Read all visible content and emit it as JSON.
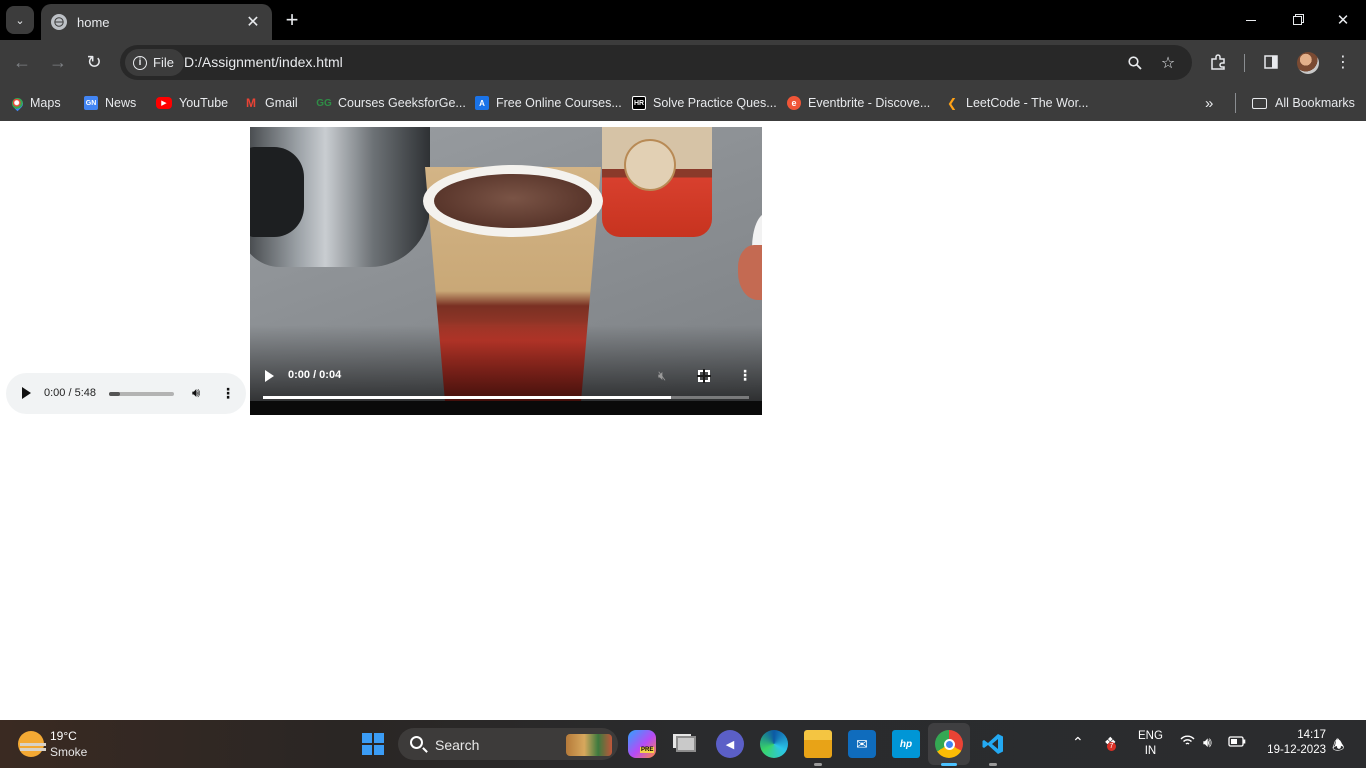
{
  "browser": {
    "tab": {
      "title": "home"
    },
    "address": {
      "scheme_label": "File",
      "url": "D:/Assignment/index.html"
    },
    "bookmarks": [
      {
        "label": "Maps"
      },
      {
        "label": "News"
      },
      {
        "label": "YouTube"
      },
      {
        "label": "Gmail"
      },
      {
        "label": "Courses GeeksforGe..."
      },
      {
        "label": "Free Online Courses..."
      },
      {
        "label": "Solve Practice Ques..."
      },
      {
        "label": "Eventbrite - Discove..."
      },
      {
        "label": "LeetCode - The Wor..."
      }
    ],
    "all_bookmarks_label": "All Bookmarks"
  },
  "page": {
    "audio": {
      "time": "0:00 / 5:48",
      "progress": 0.17
    },
    "video": {
      "time": "0:00 / 0:04",
      "buffered": 0.84
    }
  },
  "taskbar": {
    "weather": {
      "temp": "19°C",
      "condition": "Smoke"
    },
    "search_label": "Search",
    "language": {
      "line1": "ENG",
      "line2": "IN"
    },
    "clock": {
      "time": "14:17",
      "date": "19-12-2023"
    },
    "copilot_badge": "PRE",
    "dropbox_badge": "7"
  },
  "colors": {
    "chrome_dark": "#3c3c3c",
    "start_blue": "#3b9cf5",
    "accent_blue": "#4cc2ff"
  }
}
